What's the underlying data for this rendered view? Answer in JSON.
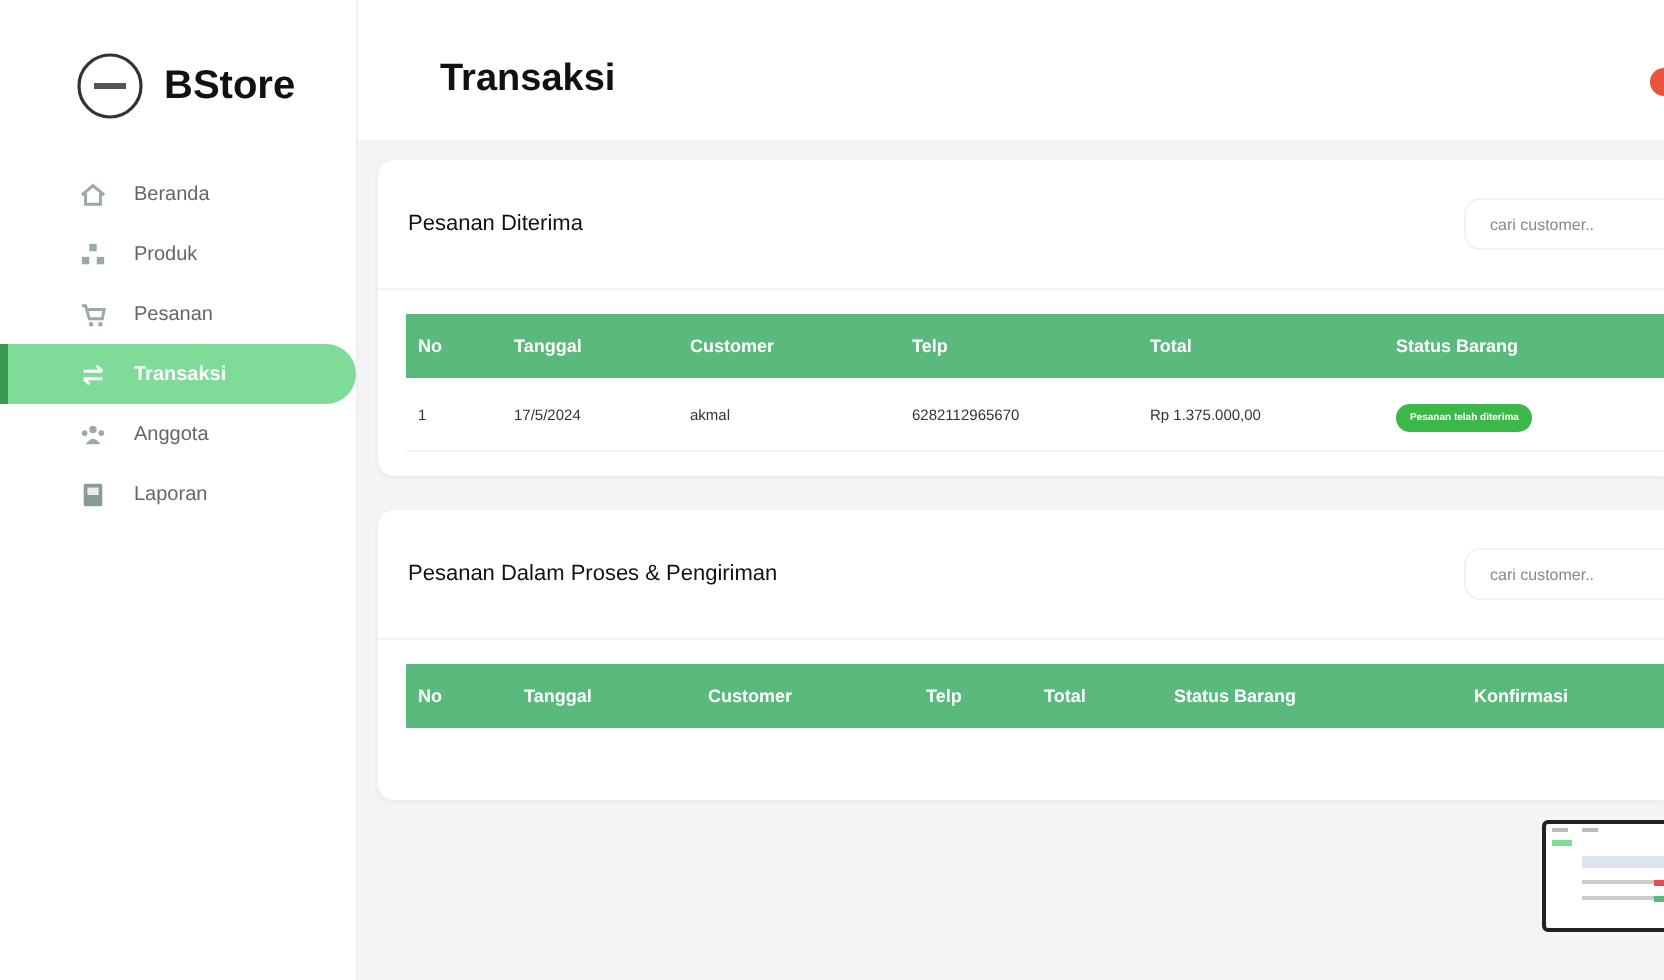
{
  "brand": {
    "name": "BStore"
  },
  "sidebar": {
    "items": [
      {
        "label": "Beranda",
        "selected": false
      },
      {
        "label": "Produk",
        "selected": false
      },
      {
        "label": "Pesanan",
        "selected": false
      },
      {
        "label": "Transaksi",
        "selected": true
      },
      {
        "label": "Anggota",
        "selected": false
      },
      {
        "label": "Laporan",
        "selected": false
      }
    ]
  },
  "header": {
    "title": "Transaksi"
  },
  "sections": [
    {
      "title": "Pesanan Diterima",
      "search": {
        "placeholder": "cari customer.."
      },
      "table": {
        "columns": [
          "No",
          "Tanggal",
          "Customer",
          "Telp",
          "Total",
          "Status Barang"
        ],
        "rows": [
          {
            "cells": [
              "1",
              "17/5/2024",
              "akmal",
              "6282112965670",
              "Rp 1.375.000,00"
            ],
            "status": {
              "label": "Pesanan telah diterima",
              "color": "#3cb84a"
            }
          }
        ]
      }
    },
    {
      "title": "Pesanan Dalam Proses & Pengiriman",
      "search": {
        "placeholder": "cari customer.."
      },
      "table": {
        "columns": [
          "No",
          "Tanggal",
          "Customer",
          "Telp",
          "Total",
          "Status Barang",
          "Konfirmasi"
        ]
      }
    }
  ]
}
